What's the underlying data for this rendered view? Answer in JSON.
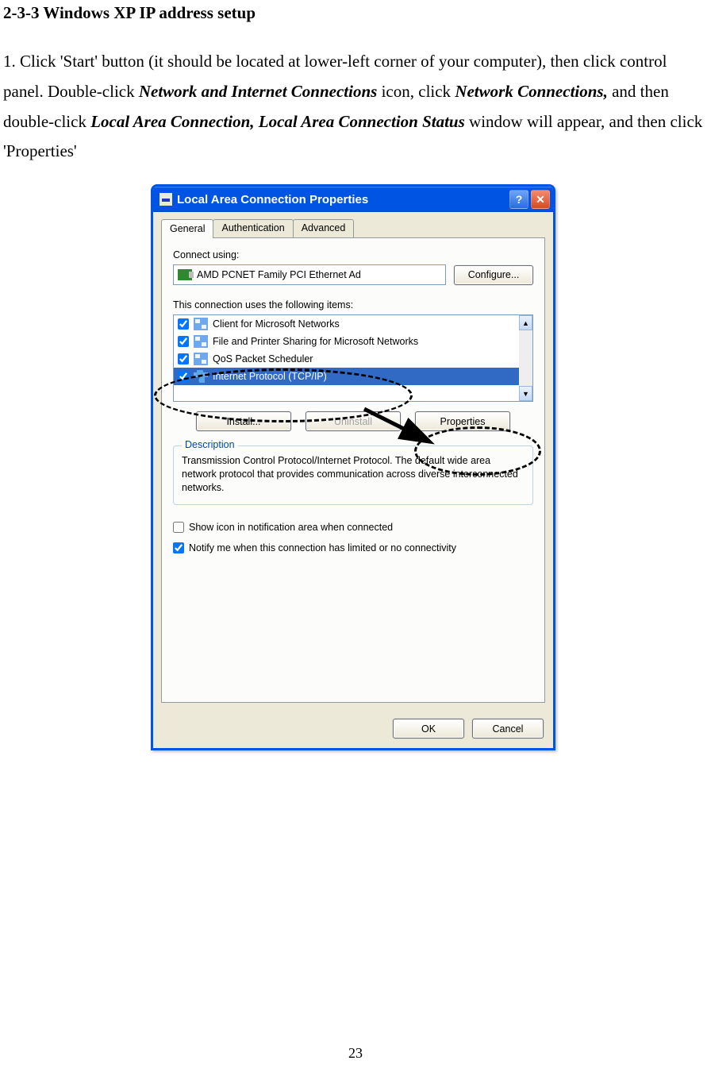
{
  "doc": {
    "heading": "2-3-3 Windows XP IP address setup",
    "para_parts": {
      "p1": "1. Click 'Start' button (it should be located at lower-left corner of your computer), then click control panel. Double-click ",
      "b1": "Network and Internet Connections",
      "p2": " icon, click ",
      "b2": "Network Connections,",
      "p3": " and then double-click ",
      "b3": "Local Area Connection, Local Area Connection Status",
      "p4": " window will appear, and then click 'Properties'"
    },
    "page_number": "23"
  },
  "dialog": {
    "title": "Local Area Connection Properties",
    "tabs": [
      "General",
      "Authentication",
      "Advanced"
    ],
    "connect_using_label": "Connect using:",
    "adapter_name": "AMD PCNET Family PCI Ethernet Ad",
    "configure_btn": "Configure...",
    "items_label": "This connection uses the following items:",
    "items": [
      {
        "label": "Client for Microsoft Networks",
        "checked": true,
        "iconType": "net"
      },
      {
        "label": "File and Printer Sharing for Microsoft Networks",
        "checked": true,
        "iconType": "net"
      },
      {
        "label": "QoS Packet Scheduler",
        "checked": true,
        "iconType": "net"
      },
      {
        "label": "Internet Protocol (TCP/IP)",
        "checked": true,
        "iconType": "tcp",
        "selected": true
      }
    ],
    "install_btn": "Install...",
    "uninstall_btn": "Uninstall",
    "properties_btn": "Properties",
    "description_title": "Description",
    "description_text": "Transmission Control Protocol/Internet Protocol. The default wide area network protocol that provides communication across diverse interconnected networks.",
    "show_icon_label": "Show icon in notification area when connected",
    "notify_label": "Notify me when this connection has limited or no connectivity",
    "show_icon_checked": false,
    "notify_checked": true,
    "ok_btn": "OK",
    "cancel_btn": "Cancel"
  }
}
